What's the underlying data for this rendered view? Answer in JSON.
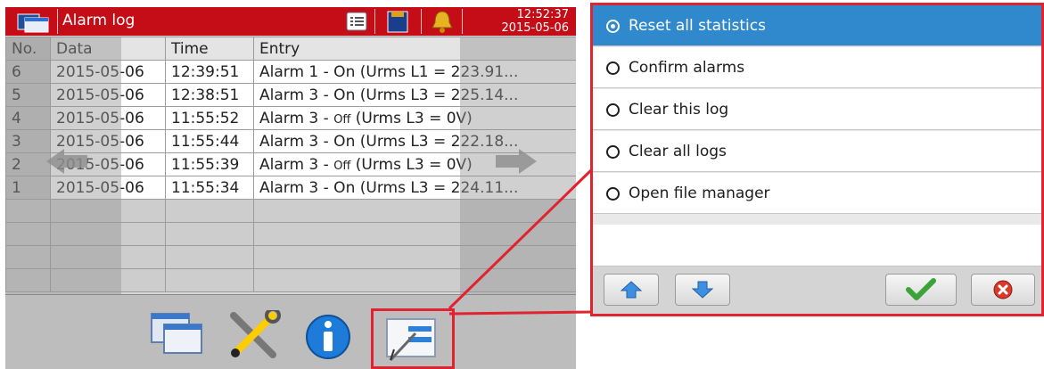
{
  "window": {
    "title": "Alarm log",
    "time": "12:52:37",
    "date": "2015-05-06",
    "accent_color": "#c40d17"
  },
  "table": {
    "headers": {
      "no": "No.",
      "data": "Data",
      "time": "Time",
      "entry": "Entry"
    },
    "rows": [
      {
        "no": "6",
        "data": "2015-05-06",
        "time": "12:39:51",
        "entry_pre": "Alarm 1 - On",
        "entry_post": " (Urms L1 = 223.91..."
      },
      {
        "no": "5",
        "data": "2015-05-06",
        "time": "12:38:51",
        "entry_pre": "Alarm 3 - On",
        "entry_post": " (Urms L3 = 225.14..."
      },
      {
        "no": "4",
        "data": "2015-05-06",
        "time": "11:55:52",
        "entry_pre": "Alarm 3 - ",
        "entry_off": "Off",
        "entry_post": "  (Urms L3 = 0V)"
      },
      {
        "no": "3",
        "data": "2015-05-06",
        "time": "11:55:44",
        "entry_pre": "Alarm 3 - On",
        "entry_post": " (Urms L3 = 222.18..."
      },
      {
        "no": "2",
        "data": "2015-05-06",
        "time": "11:55:39",
        "entry_pre": "Alarm 3 - ",
        "entry_off": "Off",
        "entry_post": "  (Urms L3 = 0V)"
      },
      {
        "no": "1",
        "data": "2015-05-06",
        "time": "11:55:34",
        "entry_pre": "Alarm 3 - On",
        "entry_post": " (Urms L3 = 224.11..."
      }
    ]
  },
  "toolbar": {
    "icons": [
      "windows-icon",
      "settings-tools-icon",
      "info-icon",
      "menu-options-icon"
    ]
  },
  "menu": {
    "items": [
      {
        "label": "Reset all statistics",
        "selected": true
      },
      {
        "label": "Confirm alarms",
        "selected": false
      },
      {
        "label": "Clear this log",
        "selected": false
      },
      {
        "label": "Clear all logs",
        "selected": false
      },
      {
        "label": "Open file manager",
        "selected": false
      }
    ],
    "highlight_color": "#2f89cc",
    "callout_color": "#e0232e"
  }
}
